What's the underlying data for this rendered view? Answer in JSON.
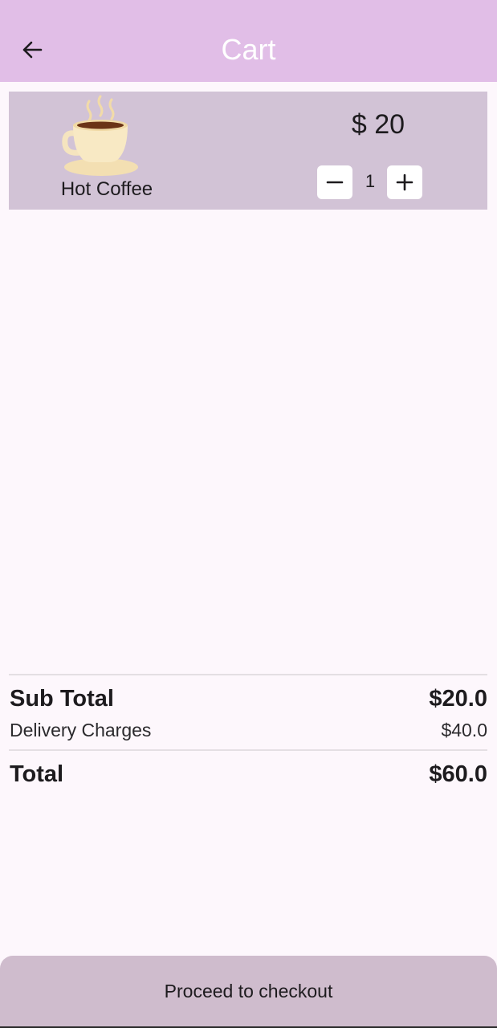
{
  "app_bar": {
    "title": "Cart",
    "back_icon": "arrow-left-icon",
    "background": "#e1bee7"
  },
  "cart": {
    "items": [
      {
        "name": "Hot Coffee",
        "price": "$ 20",
        "quantity": "1",
        "image_icon": "coffee-cup-icon",
        "minus_icon": "minus-icon",
        "plus_icon": "plus-icon"
      }
    ],
    "card_color": "#d2c3d6"
  },
  "summary": {
    "subtotal_label": "Sub Total",
    "subtotal_value": "$20.0",
    "delivery_label": "Delivery Charges",
    "delivery_value": "$40.0",
    "total_label": "Total",
    "total_value": "$60.0"
  },
  "checkout": {
    "label": "Proceed to checkout",
    "color": "#cfbccd"
  }
}
